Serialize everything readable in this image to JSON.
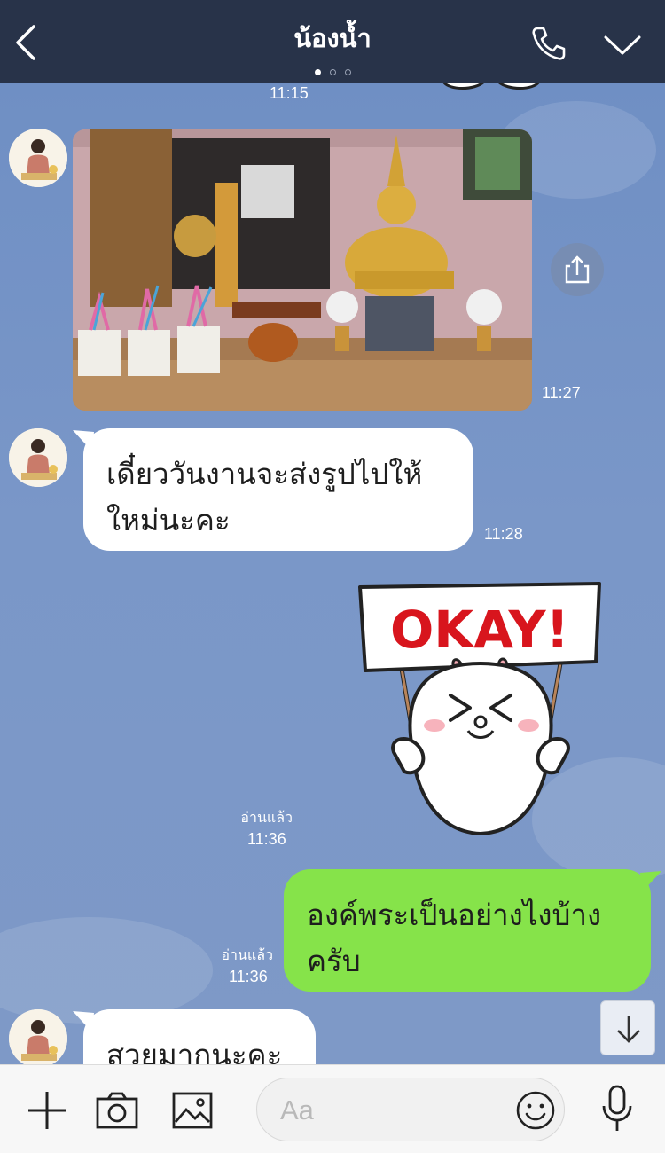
{
  "header": {
    "title": "น้องน้ำ",
    "page_dots": 3,
    "active_dot": 0
  },
  "messages": {
    "top_time": "11:15",
    "photo_time": "11:27",
    "msg1": {
      "lines": [
        "เดี๋ยววันงานจะส่งรูปไปให้",
        "ใหม่นะคะ"
      ],
      "time": "11:28"
    },
    "sticker": {
      "sign_text": "OKAY!",
      "read_label": "อ่านแล้ว",
      "time": "11:36"
    },
    "msg2": {
      "lines": [
        "องค์พระเป็นอย่างไงบ้าง",
        "ครับ"
      ],
      "read_label": "อ่านแล้ว",
      "time": "11:36"
    },
    "msg3": {
      "text": "สวยมากนะคะ"
    }
  },
  "input": {
    "placeholder": "Aa"
  },
  "colors": {
    "header_bg": "#283349",
    "chat_bg": "#7793c3",
    "outgoing_bubble": "#86e34a",
    "incoming_bubble": "#ffffff"
  },
  "icons": {
    "header": [
      "back-arrow-icon",
      "phone-icon",
      "chevron-down-icon"
    ],
    "chat": [
      "share-icon",
      "arrow-down-icon"
    ],
    "bottom": [
      "plus-icon",
      "camera-icon",
      "image-icon",
      "emoji-icon",
      "microphone-icon"
    ]
  }
}
